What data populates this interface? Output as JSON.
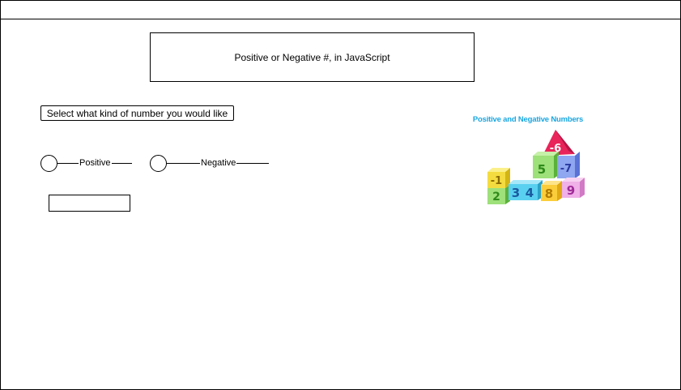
{
  "page": {
    "title": "Positive or Negative #, in JavaScript",
    "prompt_button": "Select what kind of number you would like"
  },
  "options": [
    {
      "label": "Positive"
    },
    {
      "label": "Negative"
    }
  ],
  "result": {
    "value": ""
  },
  "illustration": {
    "title": "Positive and Negative Numbers",
    "blocks": [
      "-1",
      "2",
      "3",
      "4",
      "5",
      "-6",
      "-7",
      "8",
      "9"
    ]
  },
  "colors": {
    "border": "#000000",
    "illustration_title": "#1aa6e0"
  }
}
